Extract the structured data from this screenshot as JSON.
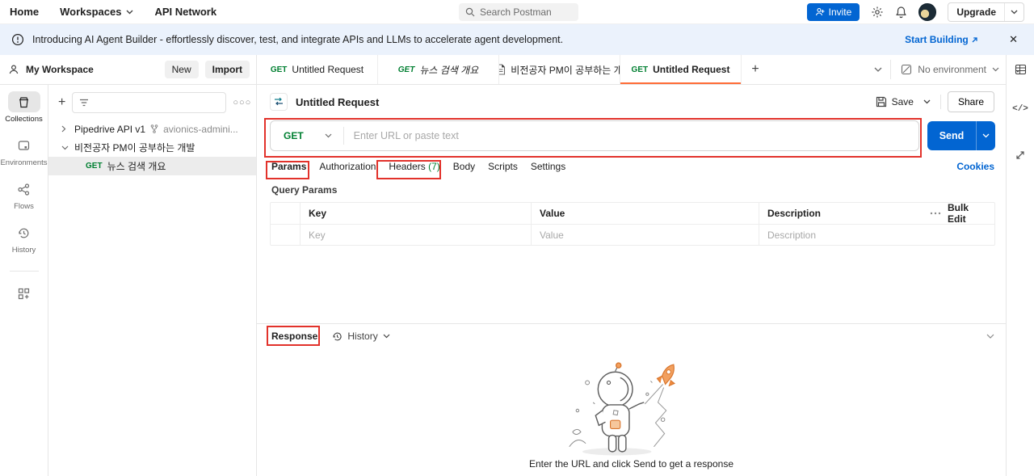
{
  "colors": {
    "accent_orange": "#FF6C37",
    "button_blue": "#0265D2",
    "method_green": "#007F31",
    "annotation_red": "#E2322B",
    "banner_bg": "#EBF2FC"
  },
  "topbar": {
    "nav": [
      {
        "label": "Home"
      },
      {
        "label": "Workspaces"
      },
      {
        "label": "API Network"
      }
    ],
    "search_placeholder": "Search Postman",
    "invite_label": "Invite",
    "upgrade_label": "Upgrade"
  },
  "banner": {
    "text": "Introducing AI Agent Builder - effortlessly discover, test, and integrate APIs and LLMs to accelerate agent development.",
    "cta_label": "Start Building",
    "close_glyph": "✕"
  },
  "sidebar": {
    "workspace_label": "My Workspace",
    "new_label": "New",
    "import_label": "Import",
    "rail": [
      {
        "label": "Collections"
      },
      {
        "label": "Environments"
      },
      {
        "label": "Flows"
      },
      {
        "label": "History"
      }
    ],
    "tree": {
      "item1": {
        "label": "Pipedrive API v1",
        "fork_label": "avionics-admini..."
      },
      "item2": {
        "label": "비전공자 PM이 공부하는 개발"
      },
      "item3": {
        "method": "GET",
        "label": "뉴스 검색 개요"
      }
    }
  },
  "tabstrip": {
    "tabs": [
      {
        "method": "GET",
        "label": "Untitled Request"
      },
      {
        "method": "GET",
        "label": "뉴스 검색 개요"
      },
      {
        "method": "",
        "label": "비전공자 PM이 공부하는 개"
      },
      {
        "method": "GET",
        "label": "Untitled Request"
      }
    ],
    "new_tab_glyph": "+",
    "environment_label": "No environment"
  },
  "request": {
    "title": "Untitled Request",
    "save_label": "Save",
    "share_label": "Share",
    "method": "GET",
    "url_placeholder": "Enter URL or paste text",
    "send_label": "Send",
    "subtabs": {
      "params": "Params",
      "authorization": "Authorization",
      "headers": "Headers",
      "headers_count": "(7)",
      "body": "Body",
      "scripts": "Scripts",
      "settings": "Settings"
    },
    "cookies_label": "Cookies",
    "query_params": {
      "title": "Query Params",
      "col_key": "Key",
      "col_value": "Value",
      "col_description": "Description",
      "bulk_edit_label": "Bulk Edit",
      "ph_key": "Key",
      "ph_value": "Value",
      "ph_description": "Description"
    }
  },
  "response": {
    "title": "Response",
    "history_label": "History",
    "empty_text": "Enter the URL and click Send to get a response"
  }
}
